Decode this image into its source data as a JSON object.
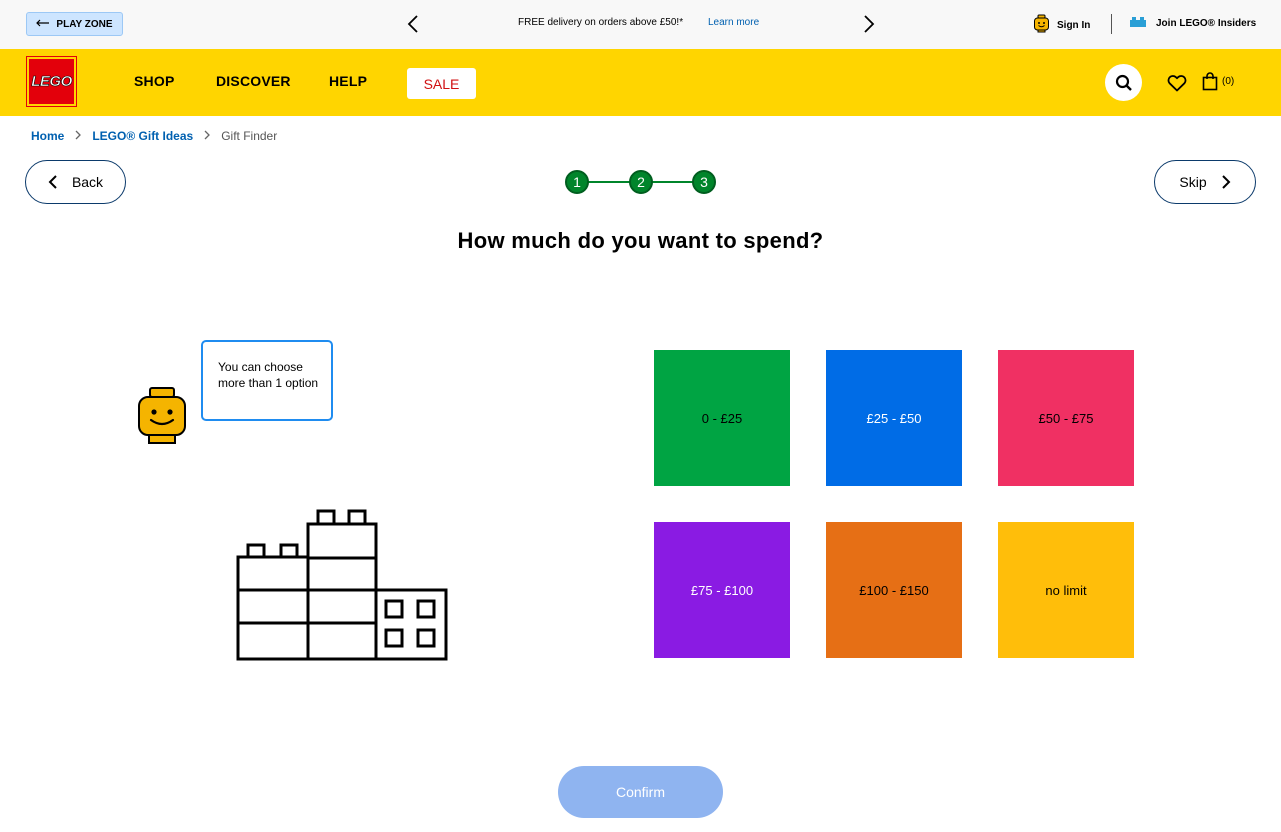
{
  "topbar": {
    "play_zone_label": "PLAY ZONE",
    "promo_text": "FREE delivery on orders above £50!*",
    "promo_link": "Learn more",
    "sign_in_label": "Sign In",
    "insiders_label": "Join LEGO® Insiders"
  },
  "nav": {
    "logo_text": "LEGO",
    "shop": "SHOP",
    "discover": "DISCOVER",
    "help": "HELP",
    "sale": "SALE",
    "bag_count": "(0)"
  },
  "breadcrumb": {
    "home": "Home",
    "gift_ideas": "LEGO® Gift Ideas",
    "current": "Gift Finder"
  },
  "wizard": {
    "back_label": "Back",
    "skip_label": "Skip",
    "steps": [
      "1",
      "2",
      "3"
    ],
    "question": "How much do you want to spend?",
    "hint": "You can choose more than 1 option",
    "options": [
      {
        "label": "0 - £25",
        "color": "#00a443",
        "text_color": "#000000"
      },
      {
        "label": "£25 - £50",
        "color": "#006ce6",
        "text_color": "#ffffff"
      },
      {
        "label": "£50 - £75",
        "color": "#f03063",
        "text_color": "#000000"
      },
      {
        "label": "£75 - £100",
        "color": "#8a1be3",
        "text_color": "#ffffff"
      },
      {
        "label": "£100 - £150",
        "color": "#e66f15",
        "text_color": "#000000"
      },
      {
        "label": "no limit",
        "color": "#ffbe0a",
        "text_color": "#000000"
      }
    ],
    "confirm_label": "Confirm"
  },
  "colors": {
    "brand_yellow": "#ffd500",
    "brand_red": "#e3000b",
    "step_green": "#00852b",
    "link_blue": "#0060b0",
    "confirm_disabled": "#8fb4f0"
  }
}
